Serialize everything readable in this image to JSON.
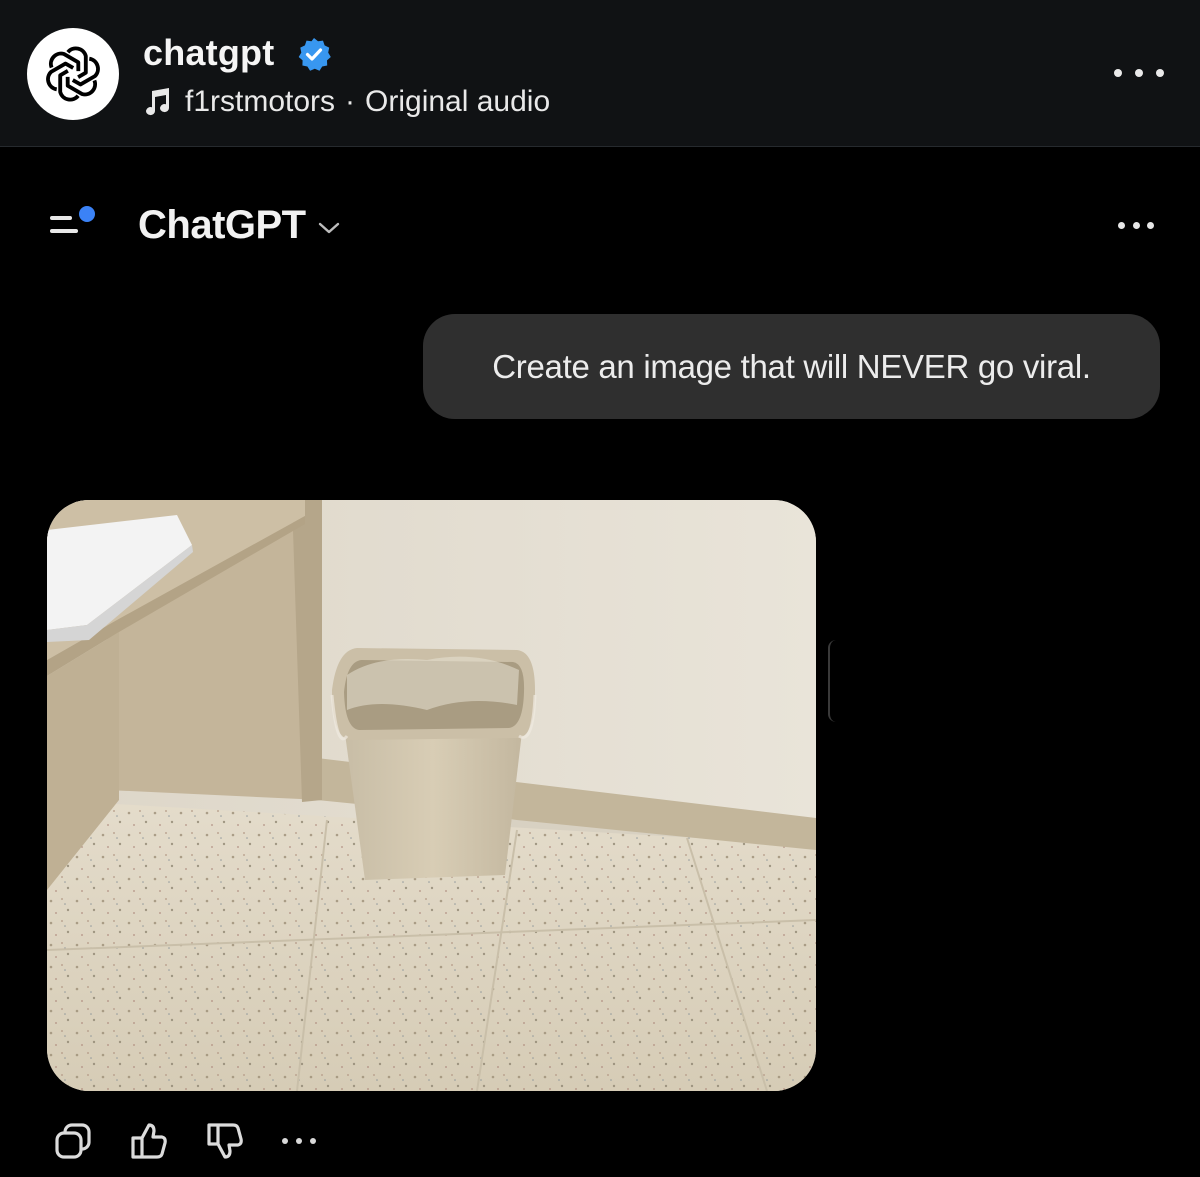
{
  "post": {
    "account_name": "chatgpt",
    "audio_author": "f1rstmotors",
    "audio_separator": "·",
    "audio_title": "Original audio",
    "icons": [
      "openai-logo-icon",
      "verified-badge-icon",
      "music-note-icon",
      "more-icon"
    ],
    "colors": {
      "header_bg": "#101214",
      "verified": "#3897f0"
    }
  },
  "chat": {
    "model_name": "ChatGPT",
    "icons": [
      "sidebar-menu-icon",
      "chevron-down-icon",
      "more-icon"
    ],
    "notification_dot_color": "#3b82f6",
    "user_message": "Create an image that will NEVER go viral.",
    "image_content": "photo-of-trash-can-in-office-corner",
    "actions": [
      "copy-icon",
      "thumbs-up-icon",
      "thumbs-down-icon",
      "more-icon"
    ],
    "colors": {
      "bubble_bg": "#2f2f2f",
      "page_bg": "#000000"
    }
  }
}
